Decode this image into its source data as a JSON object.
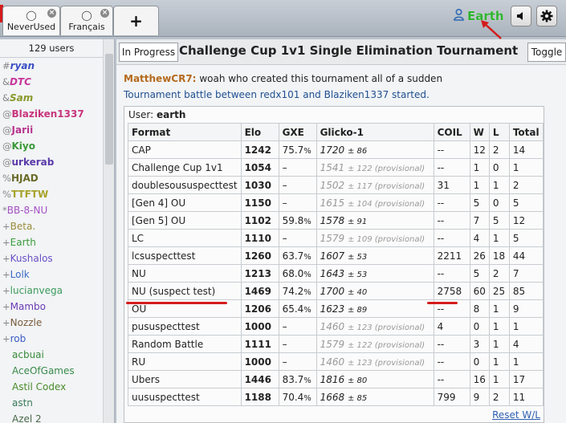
{
  "tabs": [
    {
      "label": "NeverUsed"
    },
    {
      "label": "Français"
    }
  ],
  "header": {
    "username": "Earth",
    "username_color": "#2fb32f"
  },
  "userlist": {
    "count": "129 users",
    "users": [
      {
        "group": "#",
        "name": "ryan",
        "color": "#3a4fc4",
        "style": "bi"
      },
      {
        "group": "&",
        "name": "DTC",
        "color": "#c7369a",
        "style": "bi"
      },
      {
        "group": "&",
        "name": "Sam",
        "color": "#8a9a2a",
        "style": "bi"
      },
      {
        "group": "@",
        "name": "Blaziken1337",
        "color": "#c8347c",
        "style": "b"
      },
      {
        "group": "@",
        "name": "Jarii",
        "color": "#b8348c",
        "style": "b"
      },
      {
        "group": "@",
        "name": "Kiyo",
        "color": "#3a9a3a",
        "style": "b"
      },
      {
        "group": "@",
        "name": "urkerab",
        "color": "#5a3aa8",
        "style": "b"
      },
      {
        "group": "%",
        "name": "HJAD",
        "color": "#6a6a2a",
        "style": "b"
      },
      {
        "group": "%",
        "name": "TTFTW",
        "color": "#a7a22a",
        "style": "b"
      },
      {
        "group": "*",
        "name": "BB-8-NU",
        "color": "#a64fc4",
        "style": ""
      },
      {
        "group": "+",
        "name": "Beta.",
        "color": "#9a8a3a",
        "style": ""
      },
      {
        "group": "+",
        "name": "Earth",
        "color": "#3a9a3a",
        "style": ""
      },
      {
        "group": "+",
        "name": "Kushalos",
        "color": "#6a4fc4",
        "style": ""
      },
      {
        "group": "+",
        "name": "Lolk",
        "color": "#3a6ac4",
        "style": ""
      },
      {
        "group": "+",
        "name": "lucianvega",
        "color": "#3a9a5a",
        "style": ""
      },
      {
        "group": "+",
        "name": "Mambo",
        "color": "#6a3ab4",
        "style": ""
      },
      {
        "group": "+",
        "name": "Nozzle",
        "color": "#7a5a3a",
        "style": ""
      },
      {
        "group": "+",
        "name": "rob",
        "color": "#3a5ac4",
        "style": ""
      },
      {
        "group": "",
        "name": "acbuai",
        "color": "#3a8a3a",
        "style": ""
      },
      {
        "group": "",
        "name": "AceOfGames",
        "color": "#3a8a4a",
        "style": ""
      },
      {
        "group": "",
        "name": "Astil Codex",
        "color": "#4a8a2a",
        "style": ""
      },
      {
        "group": "",
        "name": "astn",
        "color": "#3a7a5a",
        "style": ""
      },
      {
        "group": "",
        "name": "Azel 2",
        "color": "#4a6a4a",
        "style": ""
      }
    ]
  },
  "room": {
    "in_progress_label": "In Progress",
    "title": "Challenge Cup 1v1 Single Elimination Tournament",
    "toggle_label": "Toggle",
    "chat": {
      "speaker": "MatthewCR7:",
      "message": "woah who created this tournament all of a sudden",
      "notice": "Tournament battle between redx101 and Blaziken1337 started."
    }
  },
  "ladder": {
    "user_label": "User:",
    "user_value": "earth",
    "columns": [
      "Format",
      "Elo",
      "GXE",
      "Glicko-1",
      "COIL",
      "W",
      "L",
      "Total"
    ],
    "rows": [
      {
        "format": "CAP",
        "elo": "1242",
        "gxe": "75.7",
        "gxe_suffix": "%",
        "glicko": "1720",
        "dev": "± 86",
        "provisional": false,
        "coil": "--",
        "w": "12",
        "l": "2",
        "total": "14"
      },
      {
        "format": "Challenge Cup 1v1",
        "elo": "1054",
        "gxe": "–",
        "gxe_suffix": "",
        "glicko": "1541",
        "dev": "± 122 (provisional)",
        "provisional": true,
        "coil": "--",
        "w": "1",
        "l": "0",
        "total": "1"
      },
      {
        "format": "doublesoususpecttest",
        "elo": "1030",
        "gxe": "–",
        "gxe_suffix": "",
        "glicko": "1502",
        "dev": "± 117 (provisional)",
        "provisional": true,
        "coil": "31",
        "w": "1",
        "l": "1",
        "total": "2"
      },
      {
        "format": "[Gen 4] OU",
        "elo": "1150",
        "gxe": "–",
        "gxe_suffix": "",
        "glicko": "1615",
        "dev": "± 104 (provisional)",
        "provisional": true,
        "coil": "--",
        "w": "5",
        "l": "0",
        "total": "5"
      },
      {
        "format": "[Gen 5] OU",
        "elo": "1102",
        "gxe": "59.8",
        "gxe_suffix": "%",
        "glicko": "1578",
        "dev": "± 91",
        "provisional": false,
        "coil": "--",
        "w": "7",
        "l": "5",
        "total": "12"
      },
      {
        "format": "LC",
        "elo": "1110",
        "gxe": "–",
        "gxe_suffix": "",
        "glicko": "1579",
        "dev": "± 109 (provisional)",
        "provisional": true,
        "coil": "--",
        "w": "4",
        "l": "1",
        "total": "5"
      },
      {
        "format": "lcsuspecttest",
        "elo": "1260",
        "gxe": "63.7",
        "gxe_suffix": "%",
        "glicko": "1607",
        "dev": "± 53",
        "provisional": false,
        "coil": "2211",
        "w": "26",
        "l": "18",
        "total": "44"
      },
      {
        "format": "NU",
        "elo": "1213",
        "gxe": "68.0",
        "gxe_suffix": "%",
        "glicko": "1643",
        "dev": "± 53",
        "provisional": false,
        "coil": "--",
        "w": "5",
        "l": "2",
        "total": "7"
      },
      {
        "format": "NU (suspect test)",
        "elo": "1469",
        "gxe": "74.2",
        "gxe_suffix": "%",
        "glicko": "1700",
        "dev": "± 40",
        "provisional": false,
        "coil": "2758",
        "w": "60",
        "l": "25",
        "total": "85"
      },
      {
        "format": "OU",
        "elo": "1206",
        "gxe": "65.4",
        "gxe_suffix": "%",
        "glicko": "1623",
        "dev": "± 89",
        "provisional": false,
        "coil": "--",
        "w": "8",
        "l": "1",
        "total": "9"
      },
      {
        "format": "pususpecttest",
        "elo": "1000",
        "gxe": "–",
        "gxe_suffix": "",
        "glicko": "1460",
        "dev": "± 123 (provisional)",
        "provisional": true,
        "coil": "4",
        "w": "0",
        "l": "1",
        "total": "1"
      },
      {
        "format": "Random Battle",
        "elo": "1111",
        "gxe": "–",
        "gxe_suffix": "",
        "glicko": "1579",
        "dev": "± 122 (provisional)",
        "provisional": true,
        "coil": "--",
        "w": "3",
        "l": "1",
        "total": "4"
      },
      {
        "format": "RU",
        "elo": "1000",
        "gxe": "–",
        "gxe_suffix": "",
        "glicko": "1460",
        "dev": "± 123 (provisional)",
        "provisional": true,
        "coil": "--",
        "w": "0",
        "l": "1",
        "total": "1"
      },
      {
        "format": "Ubers",
        "elo": "1446",
        "gxe": "83.7",
        "gxe_suffix": "%",
        "glicko": "1816",
        "dev": "± 80",
        "provisional": false,
        "coil": "--",
        "w": "16",
        "l": "1",
        "total": "17"
      },
      {
        "format": "uususpecttest",
        "elo": "1188",
        "gxe": "70.4",
        "gxe_suffix": "%",
        "glicko": "1668",
        "dev": "± 85",
        "provisional": false,
        "coil": "799",
        "w": "9",
        "l": "2",
        "total": "11"
      }
    ],
    "reset_label": "Reset W/L"
  },
  "colors": {
    "annotation_red": "#d41c1c",
    "speaker": "#b56a1e",
    "notice": "#1f4f90",
    "link": "#2d5fb0"
  }
}
